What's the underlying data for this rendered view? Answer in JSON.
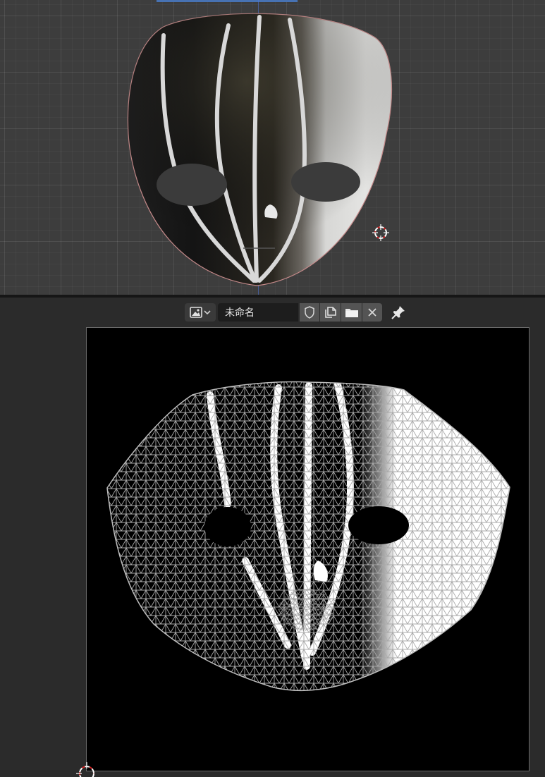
{
  "image_editor": {
    "image_name": "未命名"
  },
  "icons": {
    "editor_type": "image-icon",
    "dropdown": "chevron-down-icon",
    "fake_user": "shield-icon",
    "new_image": "duplicate-icon",
    "open_image": "folder-icon",
    "unlink": "close-icon",
    "pin": "pin-icon",
    "cursor_3d": "3d-cursor-icon",
    "cursor_2d": "2d-cursor-icon"
  },
  "colors": {
    "viewport_bg": "#3d3d3d",
    "editor_bg": "#2b2b2b",
    "active_strip": "#4772b3",
    "mask_dark": "#151515",
    "mask_light": "#e0e0e0",
    "uv_wire": "#a9a9a9",
    "canvas": "#000000"
  }
}
